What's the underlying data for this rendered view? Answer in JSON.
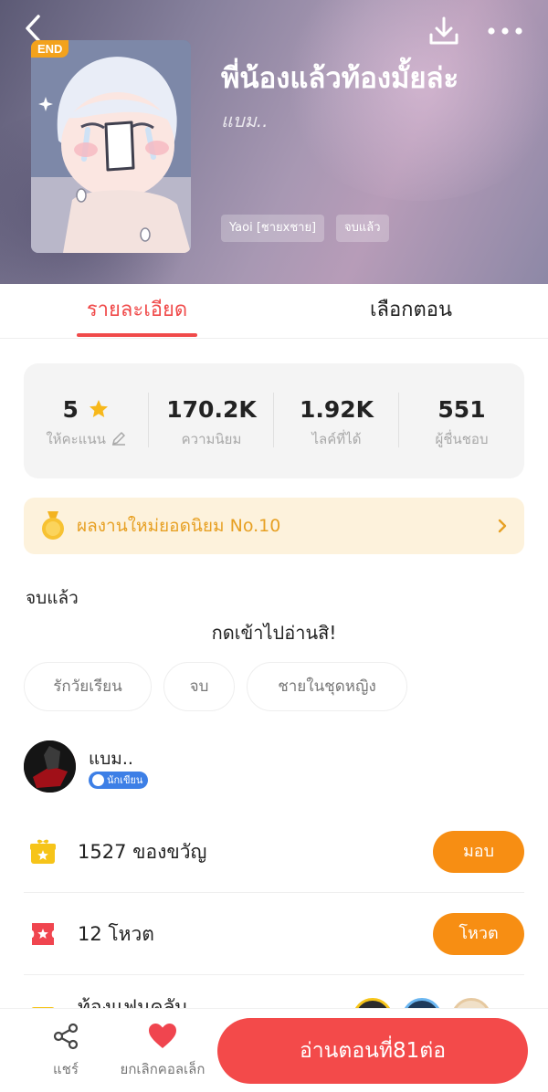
{
  "header": {
    "end_badge": "END",
    "title": "พี่น้องแล้วท้องมั้ยล่ะ",
    "author": "แบม..",
    "tags": [
      "Yaoi [ชายxชาย]",
      "จบแล้ว"
    ]
  },
  "tabs": [
    {
      "label": "รายละเอียด",
      "active": true
    },
    {
      "label": "เลือกตอน",
      "active": false
    }
  ],
  "stats": [
    {
      "value": "5",
      "label": "ให้คะแนน"
    },
    {
      "value": "170.2K",
      "label": "ความนิยม"
    },
    {
      "value": "1.92K",
      "label": "ไลค์ที่ได้"
    },
    {
      "value": "551",
      "label": "ผู้ชื่นชอบ"
    }
  ],
  "ranking_banner": {
    "text": "ผลงานใหม่ยอดนิยม No.10"
  },
  "status": "จบแล้ว",
  "description": "กดเข้าไปอ่านสิ!",
  "keywords": [
    "รักวัยเรียน",
    "จบ",
    "ชายในชุดหญิง"
  ],
  "author_card": {
    "name": "แบม..",
    "badge": "นักเขียน"
  },
  "gifts": {
    "text": "1527 ของขวัญ",
    "button": "มอบ"
  },
  "votes": {
    "text": "12 โหวต",
    "button": "โหวต"
  },
  "fan_club": {
    "text": "ท้องแฟนคลับ"
  },
  "bottom_bar": {
    "share_label": "แชร์",
    "collect_label": "ยกเลิกคอลเล็ก",
    "read_button": "อ่านตอนที่81ต่อ"
  },
  "colors": {
    "accent": "#f04a4a",
    "orange": "#f78e13",
    "gold": "#e7a023"
  }
}
